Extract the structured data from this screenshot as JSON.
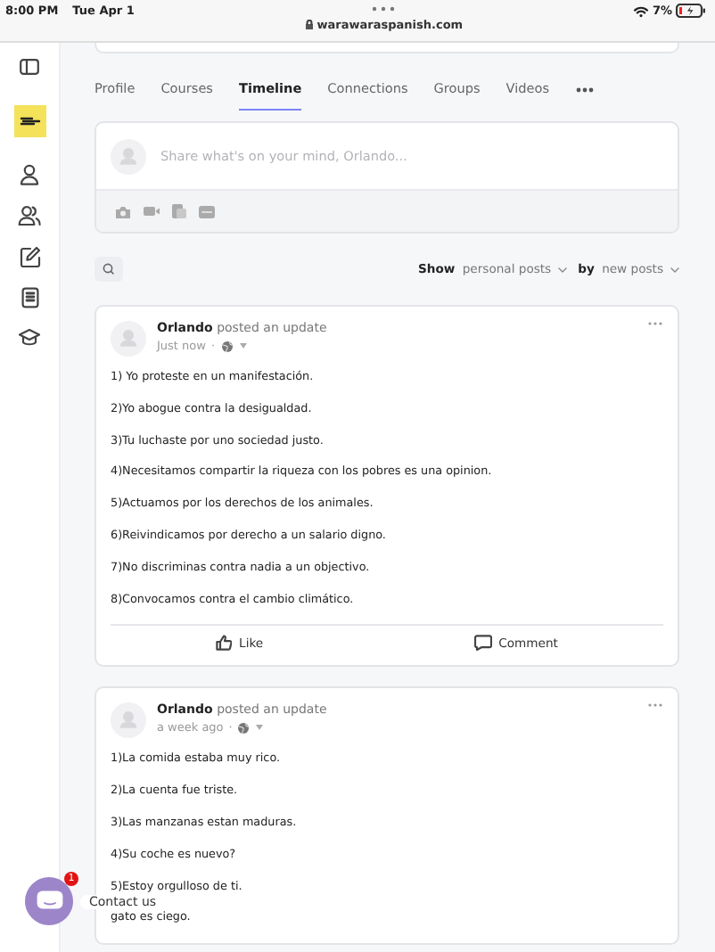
{
  "status_bar": {
    "time": "8:00 PM",
    "date": "Tue Apr 1",
    "url": "warawaraspanish.com",
    "battery": "7%"
  },
  "tabs": [
    {
      "label": "Profile",
      "selected": false
    },
    {
      "label": "Courses",
      "selected": false
    },
    {
      "label": "Timeline",
      "selected": true
    },
    {
      "label": "Connections",
      "selected": false
    },
    {
      "label": "Groups",
      "selected": false
    },
    {
      "label": "Videos",
      "selected": false
    }
  ],
  "composer": {
    "placeholder": "Share what's on your mind, Orlando..."
  },
  "filters": [
    {
      "label": "Show",
      "value": "personal posts"
    },
    {
      "label": "by",
      "value": "new posts"
    }
  ],
  "posts": [
    {
      "author": "Orlando",
      "action": "posted an update",
      "time": "Just now",
      "separator": "·",
      "lines": [
        "1) Yo proteste en un manifestación.",
        "2)Yo abogue contra la desigualdad.",
        "3)Tu luchaste por uno sociedad justo.",
        "4)Necesitamos compartir la riqueza con los pobres es una opinion.",
        "5)Actuamos por los derechos de los animales.",
        "6)Reivindicamos por derecho a un salario digno.",
        "7)No discriminas contra nadia a un objectivo.",
        "8)Convocamos contra el cambio climático."
      ],
      "actions": [
        "Like",
        "Comment"
      ]
    },
    {
      "author": "Orlando",
      "action": "posted an update",
      "time": "a week ago",
      "separator": "·",
      "lines": [
        "1)La comida estaba muy rico.",
        "2)La cuenta fue triste.",
        "3)Las manzanas estan maduras.",
        "4)Su coche es nuevo?",
        "5)Estoy orgulloso de ti.",
        "gato es ciego."
      ]
    }
  ],
  "contact": {
    "label": "Contact us",
    "badge": "1"
  }
}
